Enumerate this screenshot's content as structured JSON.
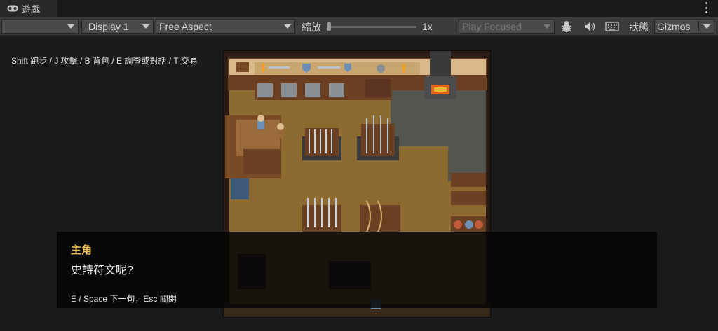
{
  "tab": {
    "title": "遊戲",
    "icon": "gamepad-icon"
  },
  "toolbar": {
    "display": "Display 1",
    "aspect": "Free Aspect",
    "scale_label": "縮放",
    "scale_value": "1x",
    "scale_fraction": 0.0,
    "play_mode": "Play Focused",
    "stats": "狀態",
    "gizmos": "Gizmos"
  },
  "hint": "Shift 跑步 / J 攻擊 / B 背包 / E 調查或對話 / T 交易",
  "dialog": {
    "speaker": "主角",
    "line": "史詩符文呢?",
    "controls": "E / Space 下一句，Esc 關閉"
  },
  "colors": {
    "speaker": "#f2c14e",
    "toolbar_bg": "#3c3c3c",
    "viewport_bg": "#1b1b1b"
  }
}
